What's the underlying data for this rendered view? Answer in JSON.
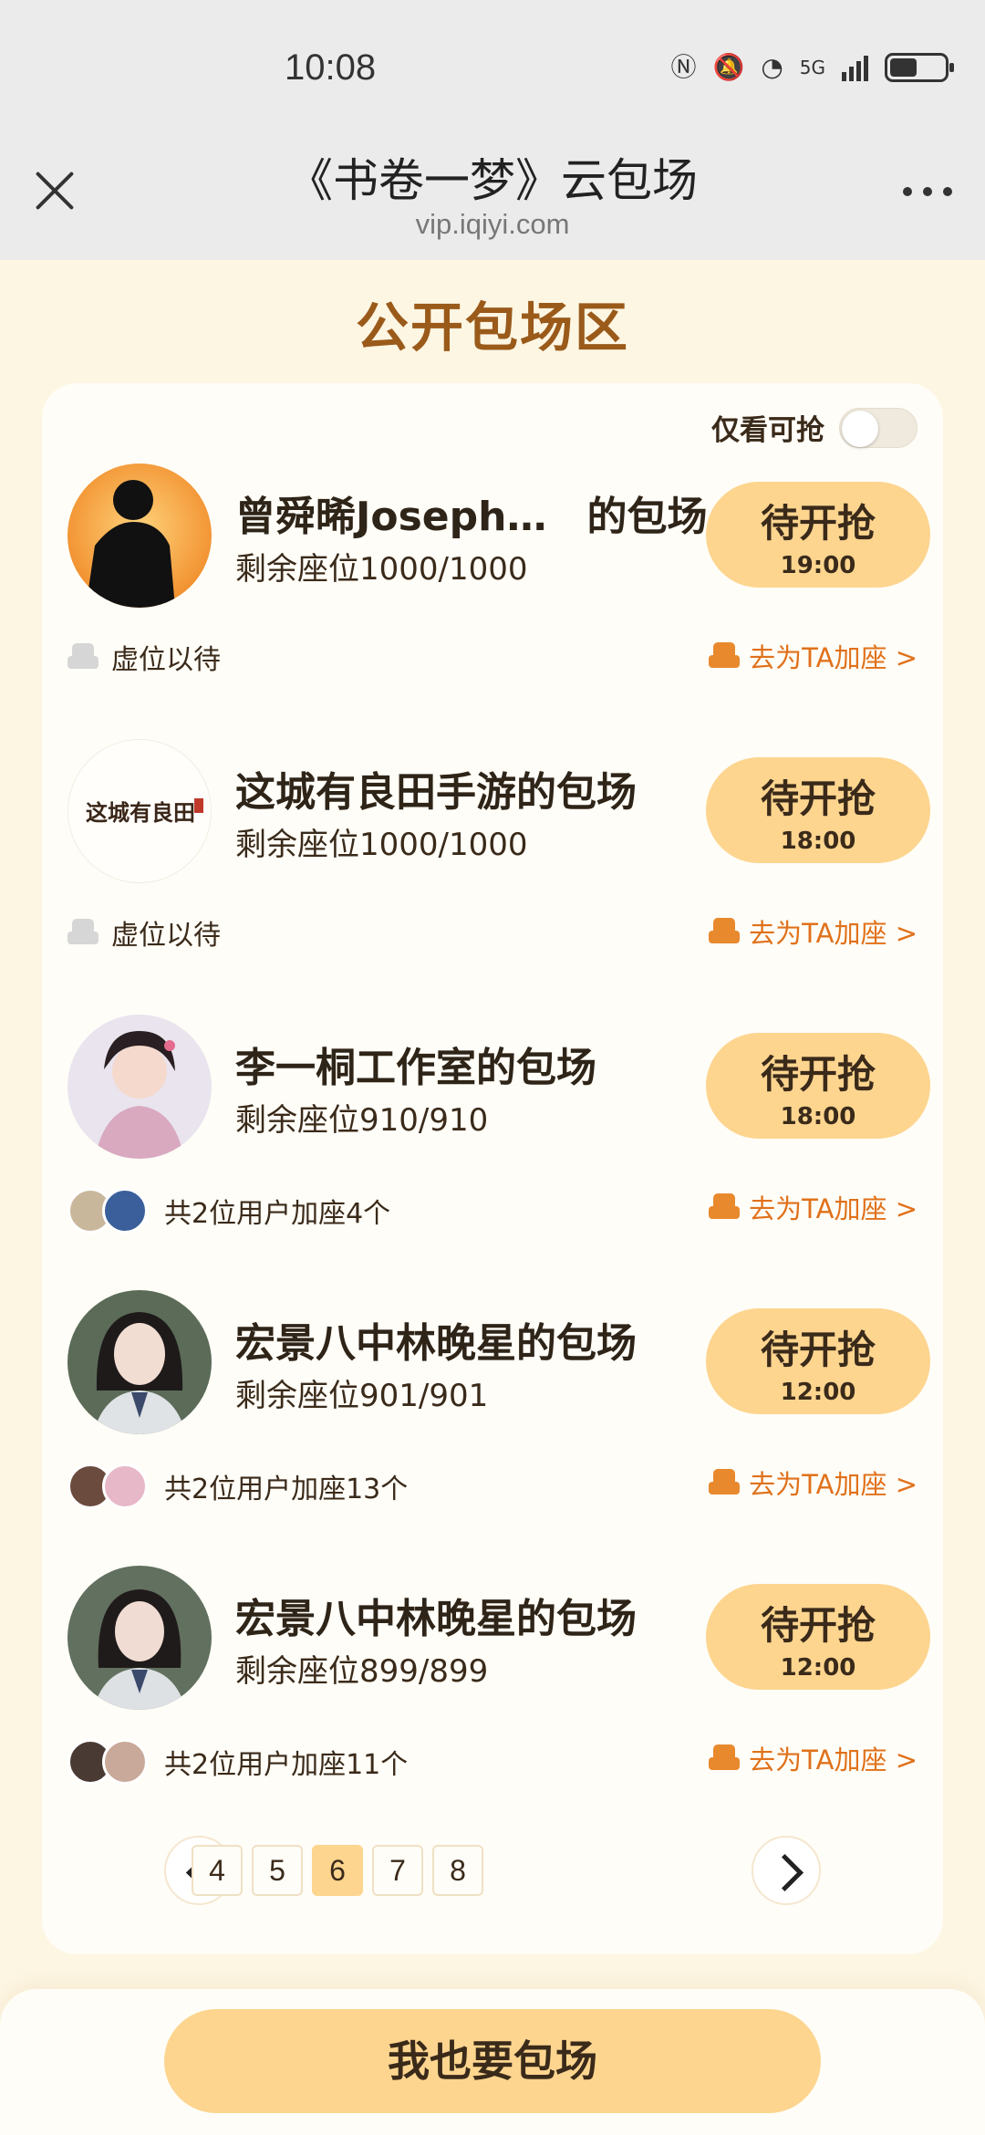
{
  "status_bar": {
    "time": "10:08",
    "network": "5G"
  },
  "header": {
    "title": "《书卷一梦》云包场",
    "url": "vip.iqiyi.com"
  },
  "section_title": "公开包场区",
  "filter": {
    "label": "仅看可抢",
    "enabled": false
  },
  "rooms": [
    {
      "name": "曾舜晞Joseph…　的包场",
      "seats": "剩余座位1000/1000",
      "button": "待开抢",
      "time": "19:00",
      "footer": "虚位以待",
      "add_seat": "去为TA加座 >",
      "avatar_desc": "silhouette-on-orange"
    },
    {
      "name": "这城有良田手游的包场",
      "seats": "剩余座位1000/1000",
      "button": "待开抢",
      "time": "18:00",
      "footer": "虚位以待",
      "add_seat": "去为TA加座 >",
      "avatar_text": "这城有良田"
    },
    {
      "name": "李一桐工作室的包场",
      "seats": "剩余座位910/910",
      "button": "待开抢",
      "time": "18:00",
      "footer": "共2位用户加座4个",
      "add_seat": "去为TA加座 >"
    },
    {
      "name": "宏景八中林晚星的包场",
      "seats": "剩余座位901/901",
      "button": "待开抢",
      "time": "12:00",
      "footer": "共2位用户加座13个",
      "add_seat": "去为TA加座 >"
    },
    {
      "name": "宏景八中林晚星的包场",
      "seats": "剩余座位899/899",
      "button": "待开抢",
      "time": "12:00",
      "footer": "共2位用户加座11个",
      "add_seat": "去为TA加座 >"
    }
  ],
  "pagination": {
    "pages": [
      "4",
      "5",
      "6",
      "7",
      "8"
    ],
    "current": "6"
  },
  "cta": "我也要包场",
  "colors": {
    "accent": "#fdd58f",
    "title_brown": "#9a5a1a",
    "orange_link": "#e0711b",
    "background": "#fdf6e3"
  }
}
